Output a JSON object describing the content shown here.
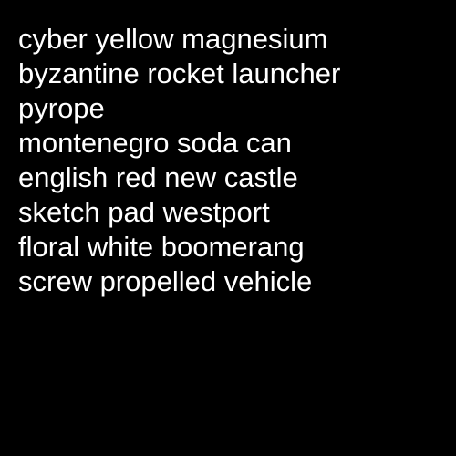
{
  "colors": {
    "background": "#000000",
    "text": "#ffffff"
  },
  "lines": [
    "cyber yellow magnesium",
    "byzantine rocket launcher",
    "pyrope",
    "montenegro soda can",
    "english red new castle",
    "sketch pad westport",
    "floral white boomerang",
    "screw propelled vehicle"
  ]
}
